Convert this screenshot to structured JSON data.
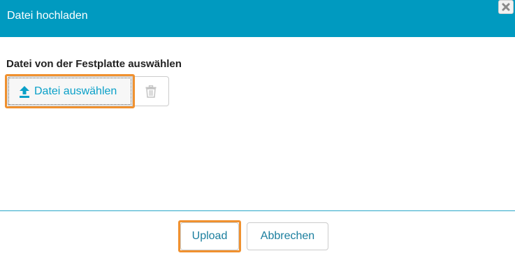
{
  "dialog": {
    "title": "Datei hochladen",
    "close_icon": "close-icon"
  },
  "section": {
    "label": "Datei von der Festplatte auswählen"
  },
  "file_picker": {
    "choose_label": "Datei auswählen",
    "choose_icon": "upload-icon",
    "delete_icon": "trash-icon"
  },
  "footer": {
    "upload_label": "Upload",
    "cancel_label": "Abbrechen"
  },
  "colors": {
    "header": "#009ac0",
    "highlight": "#f0912f",
    "link": "#0aa0c8"
  }
}
